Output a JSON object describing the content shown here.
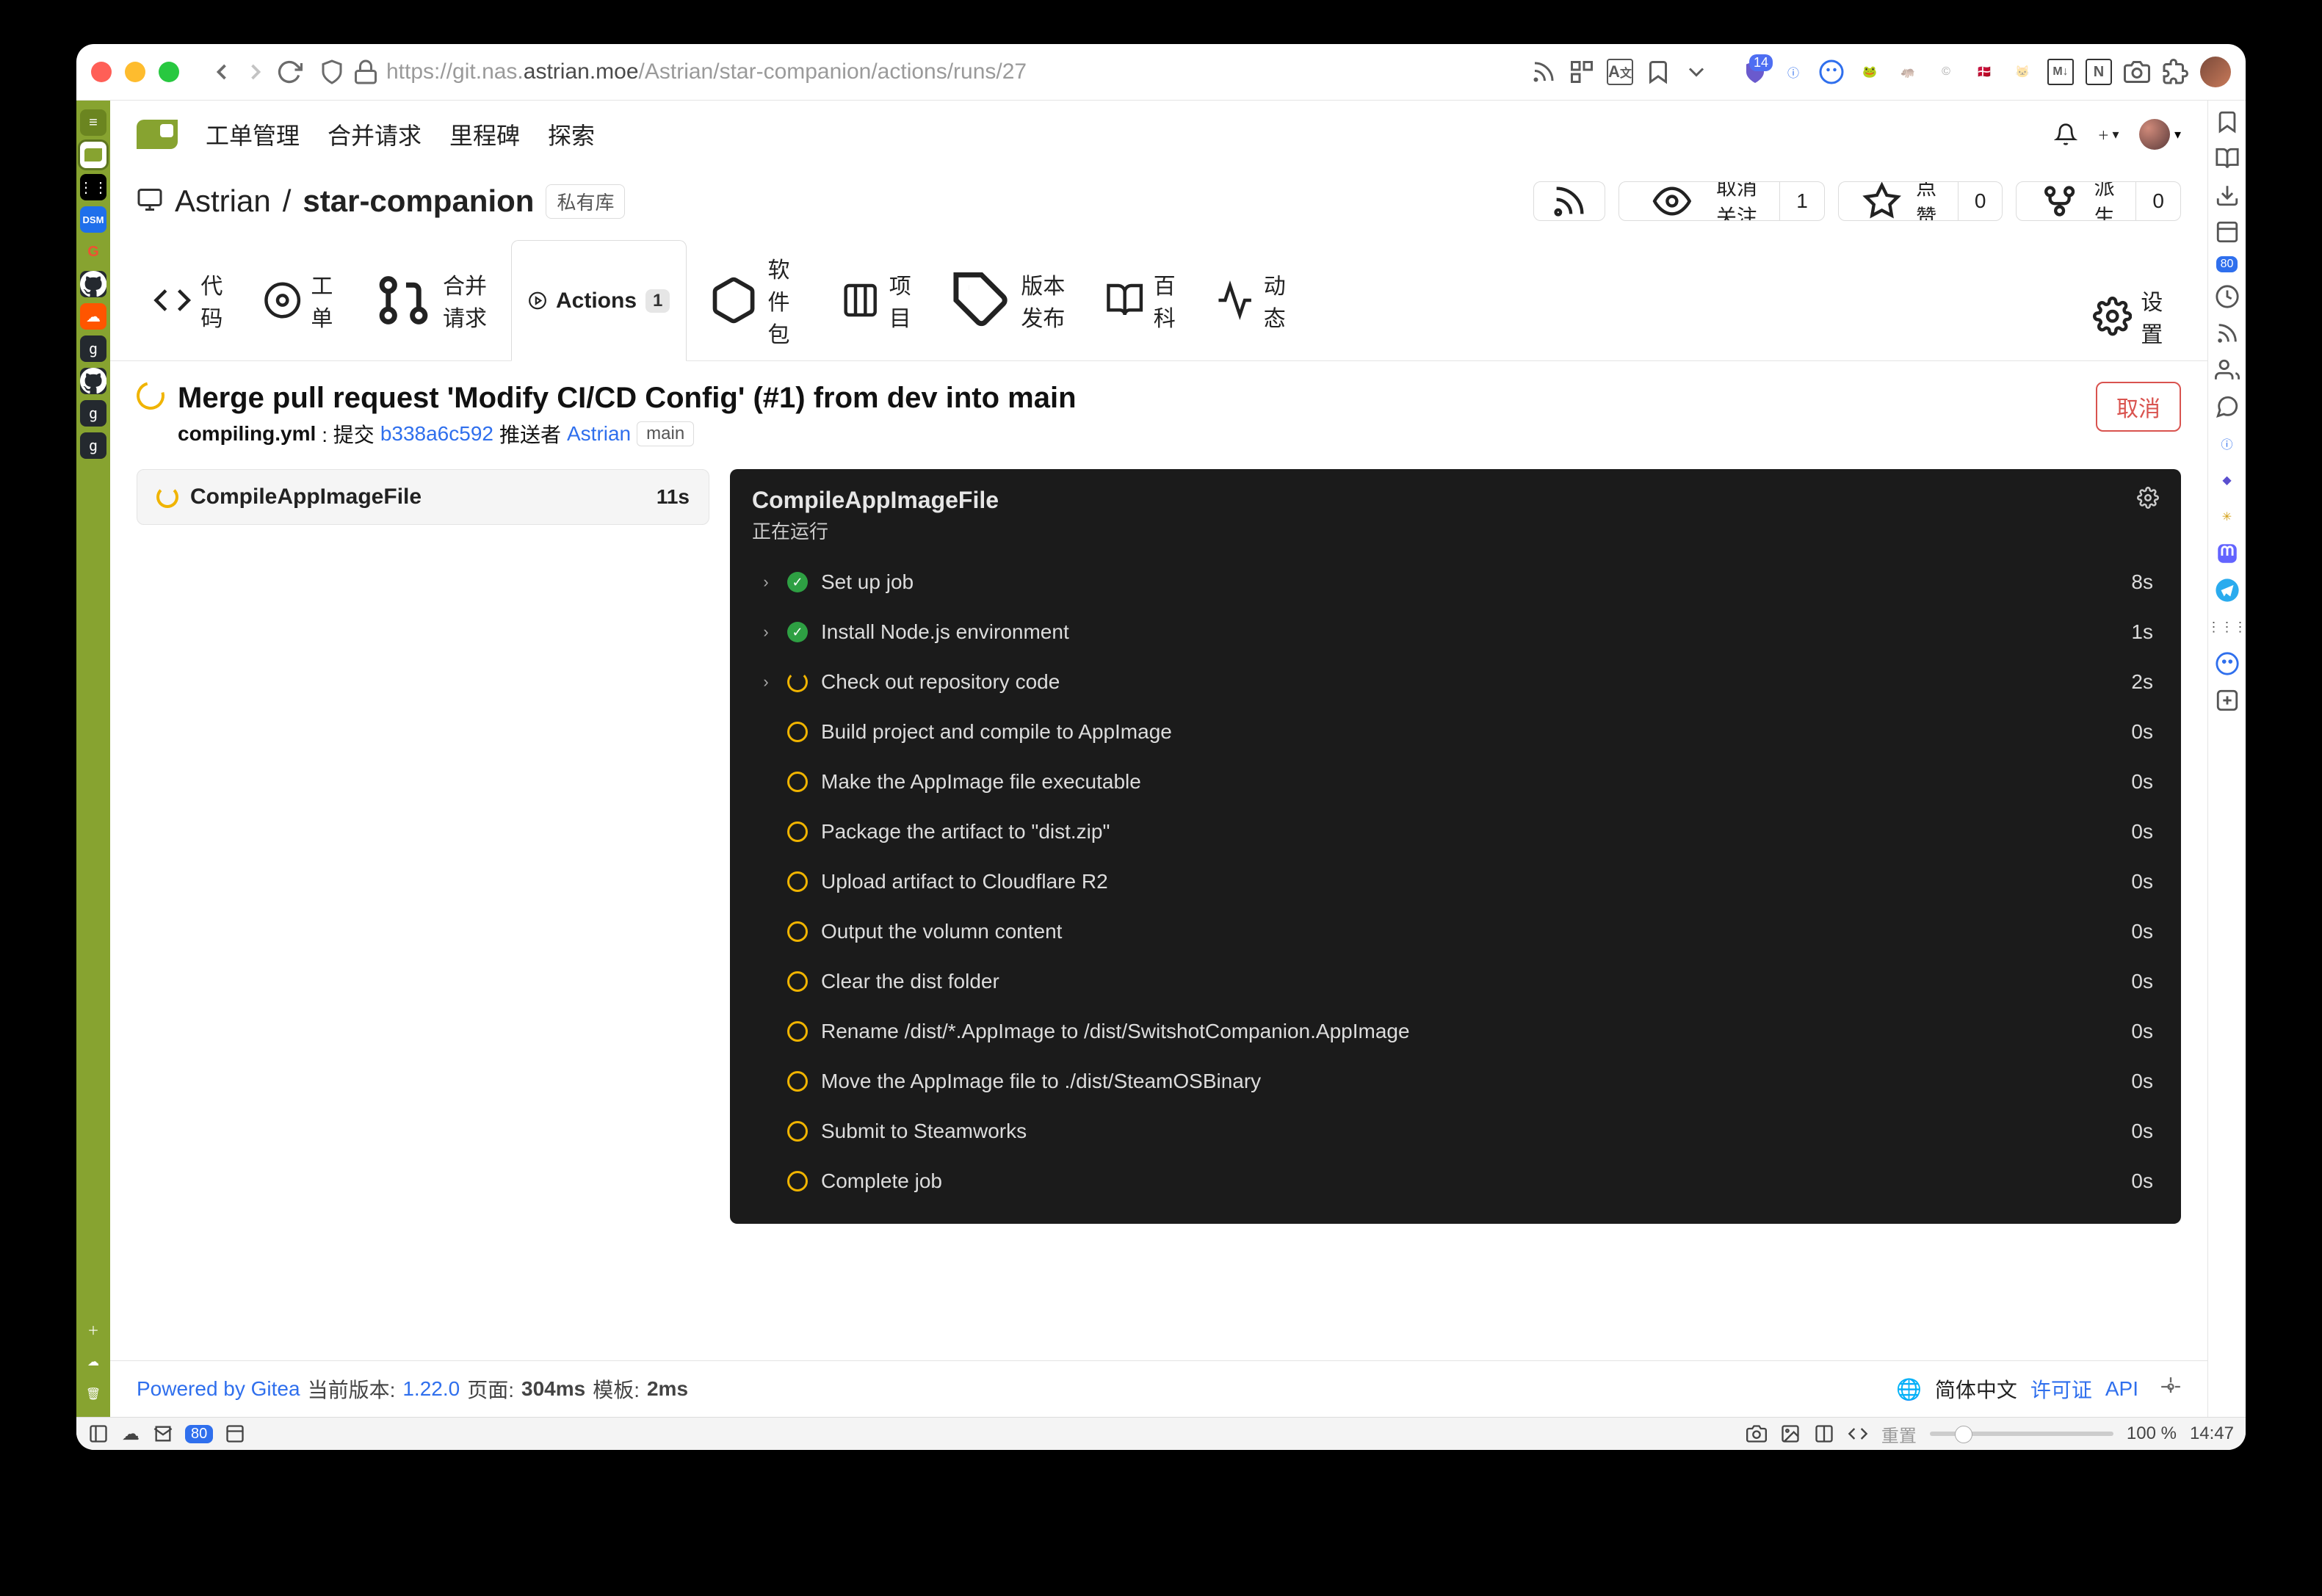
{
  "browser": {
    "url_pre": "https://git.nas.",
    "url_bold": "astrian.moe",
    "url_post": "/Astrian/star-companion/actions/runs/27",
    "ext_badge": "14"
  },
  "sidebar_badge": "80",
  "gitea_nav": {
    "issues": "工单管理",
    "pulls": "合并请求",
    "milestones": "里程碑",
    "explore": "探索"
  },
  "repo": {
    "owner": "Astrian",
    "name": "star-companion",
    "private_tag": "私有库",
    "rss": "",
    "unwatch": "取消关注",
    "unwatch_cnt": "1",
    "star": "点赞",
    "star_cnt": "0",
    "fork": "派生",
    "fork_cnt": "0"
  },
  "tabs": {
    "code": "代码",
    "issues": "工单",
    "pulls": "合并请求",
    "actions": "Actions",
    "actions_cnt": "1",
    "packages": "软件包",
    "projects": "项目",
    "releases": "版本发布",
    "wiki": "百科",
    "activity": "动态",
    "settings": "设置"
  },
  "run": {
    "title": "Merge pull request 'Modify CI/CD Config' (#1) from dev into main",
    "workflow": "compiling.yml",
    "commit_label": ": 提交",
    "sha": "b338a6c592",
    "pushed_by": "推送者",
    "pusher": "Astrian",
    "branch": "main",
    "cancel": "取消"
  },
  "job": {
    "name": "CompileAppImageFile",
    "dur": "11s"
  },
  "panel": {
    "title": "CompileAppImageFile",
    "subtitle": "正在运行",
    "steps": [
      {
        "name": "Set up job",
        "dur": "8s",
        "status": "ok",
        "expandable": true
      },
      {
        "name": "Install Node.js environment",
        "dur": "1s",
        "status": "ok",
        "expandable": true
      },
      {
        "name": "Check out repository code",
        "dur": "2s",
        "status": "spin",
        "expandable": true
      },
      {
        "name": "Build project and compile to AppImage",
        "dur": "0s",
        "status": "wait",
        "expandable": false
      },
      {
        "name": "Make the AppImage file executable",
        "dur": "0s",
        "status": "wait",
        "expandable": false
      },
      {
        "name": "Package the artifact to \"dist.zip\"",
        "dur": "0s",
        "status": "wait",
        "expandable": false
      },
      {
        "name": "Upload artifact to Cloudflare R2",
        "dur": "0s",
        "status": "wait",
        "expandable": false
      },
      {
        "name": "Output the volumn content",
        "dur": "0s",
        "status": "wait",
        "expandable": false
      },
      {
        "name": "Clear the dist folder",
        "dur": "0s",
        "status": "wait",
        "expandable": false
      },
      {
        "name": "Rename /dist/*.AppImage to /dist/SwitshotCompanion.AppImage",
        "dur": "0s",
        "status": "wait",
        "expandable": false
      },
      {
        "name": "Move the AppImage file to ./dist/SteamOSBinary",
        "dur": "0s",
        "status": "wait",
        "expandable": false
      },
      {
        "name": "Submit to Steamworks",
        "dur": "0s",
        "status": "wait",
        "expandable": false
      },
      {
        "name": "Complete job",
        "dur": "0s",
        "status": "wait",
        "expandable": false
      }
    ]
  },
  "footer": {
    "powered": "Powered by Gitea",
    "ver_label": "当前版本:",
    "ver": "1.22.0",
    "page_label": "页面:",
    "page_time": "304ms",
    "tmpl_label": "模板:",
    "tmpl_time": "2ms",
    "lang": "简体中文",
    "license": "许可证",
    "api": "API"
  },
  "statusbar": {
    "tabs_badge": "80",
    "reset": "重置",
    "zoom": "100 %",
    "clock": "14:47"
  }
}
